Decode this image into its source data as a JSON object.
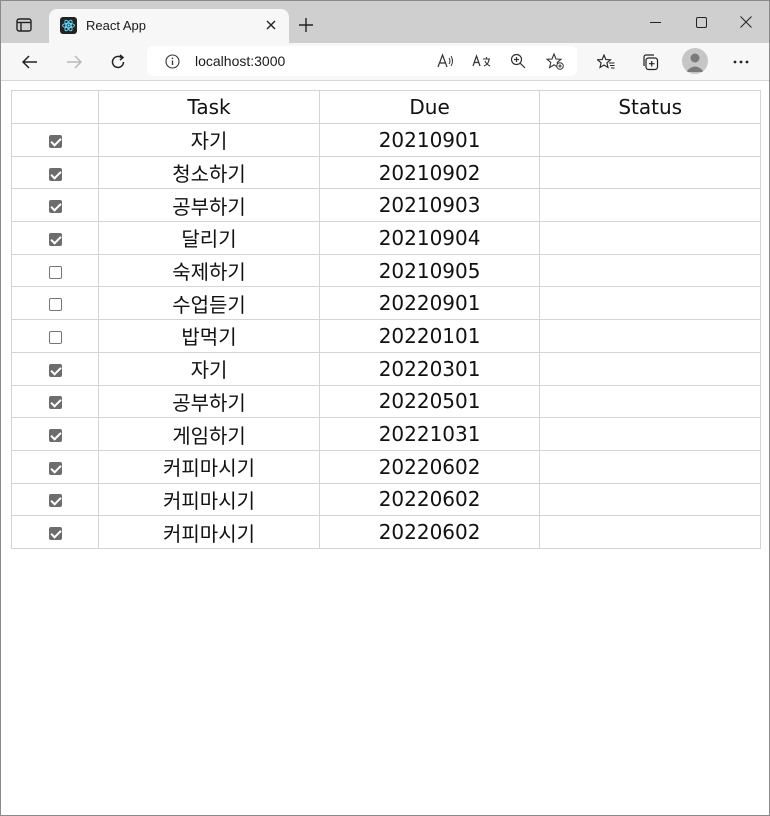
{
  "browser": {
    "tab_title": "React App",
    "url": "localhost:3000"
  },
  "table": {
    "headers": [
      "",
      "Task",
      "Due",
      "Status"
    ],
    "rows": [
      {
        "checked": true,
        "task": "자기",
        "due": "20210901",
        "status": ""
      },
      {
        "checked": true,
        "task": "청소하기",
        "due": "20210902",
        "status": ""
      },
      {
        "checked": true,
        "task": "공부하기",
        "due": "20210903",
        "status": ""
      },
      {
        "checked": true,
        "task": "달리기",
        "due": "20210904",
        "status": ""
      },
      {
        "checked": false,
        "task": "숙제하기",
        "due": "20210905",
        "status": ""
      },
      {
        "checked": false,
        "task": "수업듣기",
        "due": "20220901",
        "status": ""
      },
      {
        "checked": false,
        "task": "밥먹기",
        "due": "20220101",
        "status": ""
      },
      {
        "checked": true,
        "task": "자기",
        "due": "20220301",
        "status": ""
      },
      {
        "checked": true,
        "task": "공부하기",
        "due": "20220501",
        "status": ""
      },
      {
        "checked": true,
        "task": "게임하기",
        "due": "20221031",
        "status": ""
      },
      {
        "checked": true,
        "task": "커피마시기",
        "due": "20220602",
        "status": ""
      },
      {
        "checked": true,
        "task": "커피마시기",
        "due": "20220602",
        "status": ""
      },
      {
        "checked": true,
        "task": "커피마시기",
        "due": "20220602",
        "status": ""
      }
    ]
  },
  "icons": {
    "tab_actions": "tab-actions-icon",
    "favicon": "react-logo-icon",
    "close": "close-icon",
    "new_tab": "plus-icon",
    "back": "arrow-left-icon",
    "forward": "arrow-right-icon",
    "refresh": "refresh-icon",
    "info": "info-icon",
    "read_aloud": "read-aloud-icon",
    "translate": "translate-icon",
    "zoom": "zoom-icon",
    "favorite_add": "star-add-icon",
    "favorites": "favorites-icon",
    "collections": "collections-icon",
    "profile": "avatar",
    "more": "more-icon"
  }
}
